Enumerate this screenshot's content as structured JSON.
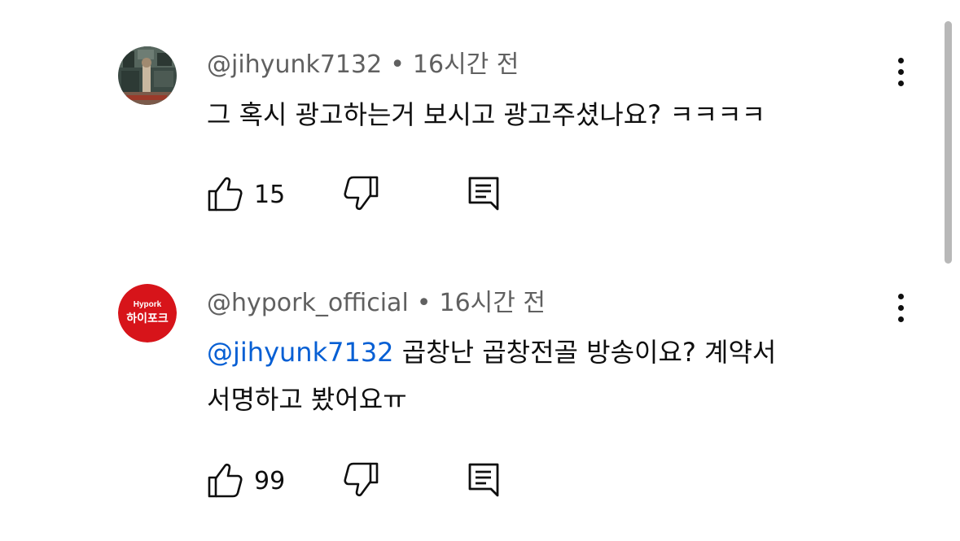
{
  "comments": [
    {
      "author": "@jihyunk7132",
      "separator": "•",
      "time": "16시간 전",
      "mention": "",
      "text_line1": "그 혹시 광고하는거 보시고 광고주셨나요? ㅋㅋㅋㅋ",
      "text_line2": "",
      "likes": "15",
      "avatar_icon": "illustrated-room-avatar"
    },
    {
      "author": "@hypork_official",
      "separator": "•",
      "time": "16시간 전",
      "mention": "@jihyunk7132",
      "text_line1": " 곱창난 곱창전골 방송이요? 계약서",
      "text_line2": "서명하고 봤어요ㅠ",
      "likes": "99",
      "avatar_logo_top": "Hypork",
      "avatar_logo_main": "하이포크"
    }
  ],
  "colors": {
    "mention": "#065fd4",
    "meta": "#606060",
    "brand_red": "#d7141a"
  }
}
